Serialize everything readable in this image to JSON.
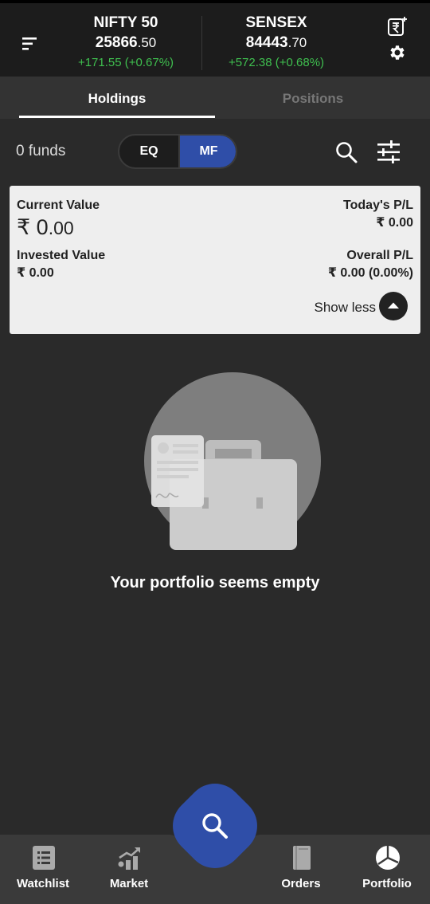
{
  "header": {
    "nifty": {
      "name": "NIFTY 50",
      "value_int": "25866",
      "value_dec": ".50",
      "change": "+171.55  (+0.67%)"
    },
    "sensex": {
      "name": "SENSEX",
      "value_int": "84443",
      "value_dec": ".70",
      "change": "+572.38 (+0.68%)"
    },
    "positive_color": "#3fbf4f"
  },
  "tabs": {
    "holdings": "Holdings",
    "positions": "Positions",
    "active": "Holdings"
  },
  "funds": {
    "label": "0 funds",
    "toggle_eq": "EQ",
    "toggle_mf": "MF",
    "selected": "MF",
    "accent": "#2f4ea8"
  },
  "summary": {
    "current_value_label": "Current Value",
    "current_value_int": "₹ 0",
    "current_value_dec": ".00",
    "todays_pl_label": "Today's P/L",
    "todays_pl_value": "₹ 0.00",
    "invested_value_label": "Invested Value",
    "invested_value": "₹ 0.00",
    "overall_pl_label": "Overall P/L",
    "overall_pl_value": "₹ 0.00 (0.00%)",
    "show_less": "Show less"
  },
  "empty_state": {
    "message": "Your portfolio seems empty"
  },
  "bottom_nav": [
    {
      "label": "Watchlist",
      "icon": "watchlist-icon"
    },
    {
      "label": "Market",
      "icon": "market-chart-icon"
    },
    {
      "label": "Orders",
      "icon": "orders-book-icon"
    },
    {
      "label": "Portfolio",
      "icon": "pie-chart-icon"
    }
  ]
}
